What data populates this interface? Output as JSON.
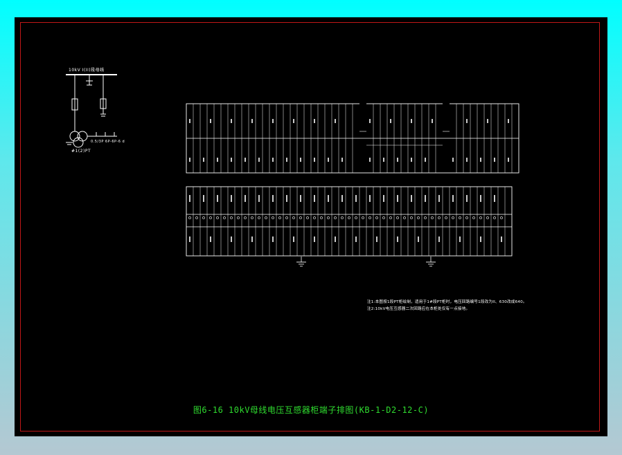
{
  "drawing": {
    "caption": "图6-16 10kV母线电压互感器柜端子排图(KB-1-D2-12-C)",
    "notes": [
      "注1:本图按1段PT柜绘制，适用于1#段PT柜时，电压回路编号1段改为II、630改成640。",
      "注2:10kV电压互感器二次回路应在本柜处仅有一点接地。"
    ],
    "single_line": {
      "bus_label": "10kV I(II)段母线",
      "pt_label": "#1(2)PT",
      "secondary_label": "0.5/3P 6P-6P-6 d"
    }
  },
  "colors": {
    "background": "#000000",
    "frame": "#c01818",
    "lines": "#ffffff",
    "caption": "#2fdc2f"
  }
}
